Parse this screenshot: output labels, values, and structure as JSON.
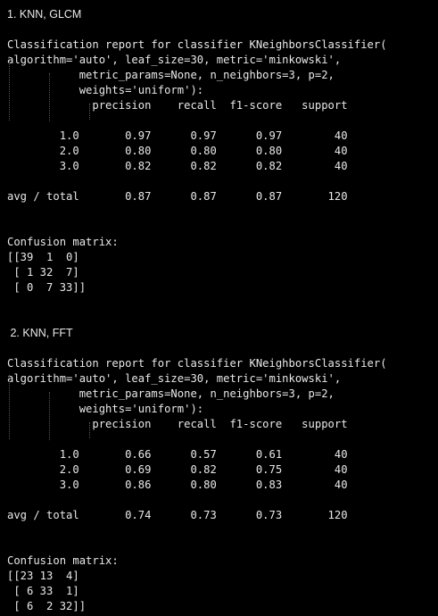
{
  "sections": [
    {
      "heading": "1. KNN, GLCM",
      "report_lines": [
        "Classification report for classifier KNeighborsClassifier(",
        "algorithm='auto', leaf_size=30, metric='minkowski',",
        "           metric_params=None, n_neighbors=3, p=2,",
        "           weights='uniform'):",
        "             precision    recall  f1-score   support",
        "",
        "        1.0       0.97      0.97      0.97        40",
        "        2.0       0.80      0.80      0.80        40",
        "        3.0       0.82      0.82      0.82        40",
        "",
        "avg / total       0.87      0.87      0.87       120"
      ],
      "confusion_title": "Confusion matrix:",
      "confusion_rows": [
        "[[39  1  0]",
        " [ 1 32  7]",
        " [ 0  7 33]]"
      ]
    },
    {
      "heading": " 2. KNN, FFT",
      "report_lines": [
        "Classification report for classifier KNeighborsClassifier(",
        "algorithm='auto', leaf_size=30, metric='minkowski',",
        "           metric_params=None, n_neighbors=3, p=2,",
        "           weights='uniform'):",
        "             precision    recall  f1-score   support",
        "",
        "        1.0       0.66      0.57      0.61        40",
        "        2.0       0.69      0.82      0.75        40",
        "        3.0       0.86      0.80      0.83        40",
        "",
        "avg / total       0.74      0.73      0.73       120"
      ],
      "confusion_title": "Confusion matrix:",
      "confusion_rows": [
        "[[23 13  4]",
        " [ 6 33  1]",
        " [ 6  2 32]]"
      ]
    }
  ]
}
